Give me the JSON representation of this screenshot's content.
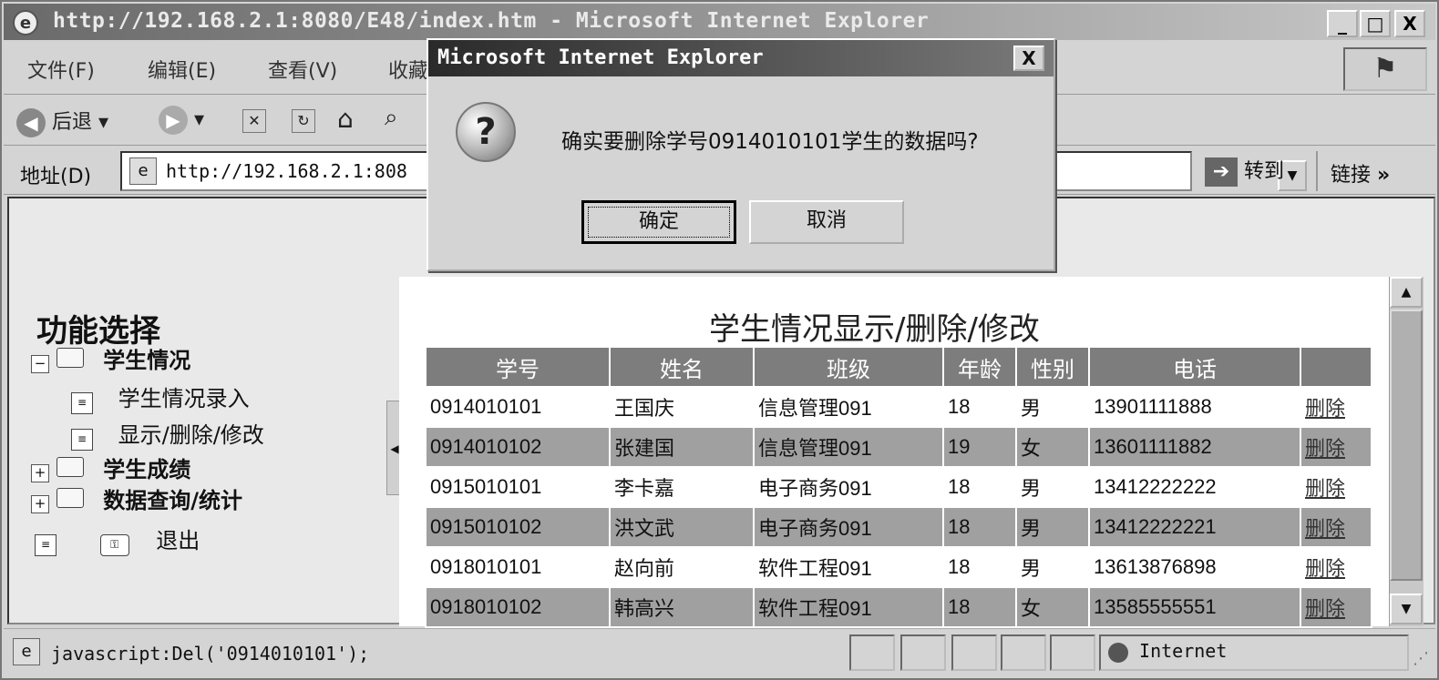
{
  "window": {
    "title": "http://192.168.2.1:8080/E48/index.htm - Microsoft Internet Explorer",
    "minimize": "_",
    "maximize": "□",
    "close": "X"
  },
  "menubar": {
    "items": [
      "文件(F)",
      "编辑(E)",
      "查看(V)",
      "收藏"
    ]
  },
  "toolbar": {
    "back_label": "后退"
  },
  "addressbar": {
    "label": "地址(D)",
    "url": "http://192.168.2.1:808",
    "go_label": "转到",
    "links_label": "链接"
  },
  "sidebar": {
    "title": "功能选择",
    "items": [
      {
        "label": "学生情况"
      },
      {
        "label": "学生情况录入"
      },
      {
        "label": "显示/删除/修改"
      },
      {
        "label": "学生成绩"
      },
      {
        "label": "数据查询/统计"
      },
      {
        "label": "退出"
      }
    ]
  },
  "main": {
    "title": "学生情况显示/删除/修改",
    "columns": [
      "学号",
      "姓名",
      "班级",
      "年龄",
      "性别",
      "电话",
      ""
    ],
    "rows": [
      {
        "id": "0914010101",
        "name": "王国庆",
        "class": "信息管理091",
        "age": "18",
        "gender": "男",
        "phone": "13901111888",
        "action": "删除"
      },
      {
        "id": "0914010102",
        "name": "张建国",
        "class": "信息管理091",
        "age": "19",
        "gender": "女",
        "phone": "13601111882",
        "action": "删除"
      },
      {
        "id": "0915010101",
        "name": "李卡嘉",
        "class": "电子商务091",
        "age": "18",
        "gender": "男",
        "phone": "13412222222",
        "action": "删除"
      },
      {
        "id": "0915010102",
        "name": "洪文武",
        "class": "电子商务091",
        "age": "18",
        "gender": "男",
        "phone": "13412222221",
        "action": "删除"
      },
      {
        "id": "0918010101",
        "name": "赵向前",
        "class": "软件工程091",
        "age": "18",
        "gender": "男",
        "phone": "13613876898",
        "action": "删除"
      },
      {
        "id": "0918010102",
        "name": "韩高兴",
        "class": "软件工程091",
        "age": "18",
        "gender": "女",
        "phone": "13585555551",
        "action": "删除"
      }
    ]
  },
  "statusbar": {
    "text": "javascript:Del('0914010101');",
    "zone": "Internet"
  },
  "dialog": {
    "title": "Microsoft Internet Explorer",
    "close": "X",
    "message": "确实要删除学号0914010101学生的数据吗?",
    "ok_label": "确定",
    "cancel_label": "取消"
  }
}
